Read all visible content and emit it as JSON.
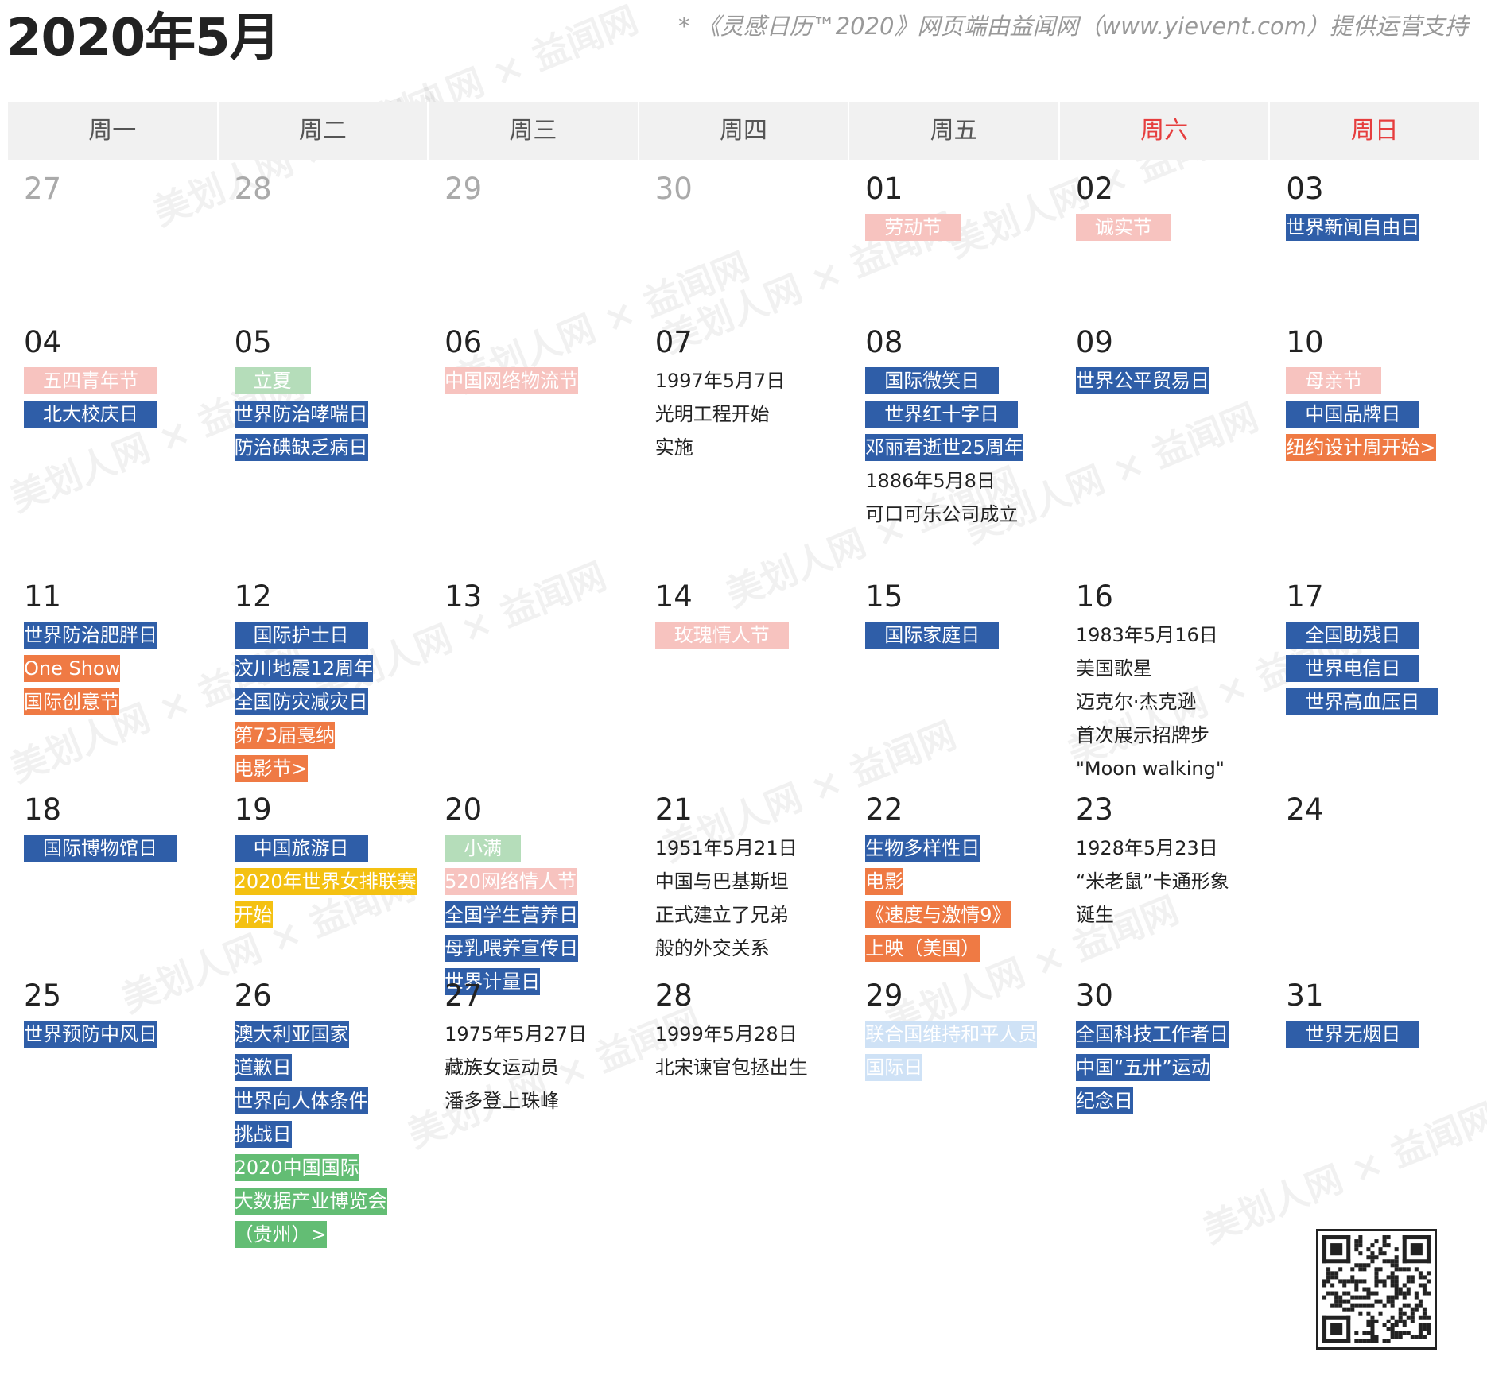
{
  "header": {
    "title": "2020年5月",
    "credit": "* 《灵感日历™2020》网页端由益闻网（www.yievent.com）提供运营支持"
  },
  "watermark": {
    "text": "美划人网 × 益闻网"
  },
  "weekdays": [
    {
      "label": "周一",
      "weekend": false
    },
    {
      "label": "周二",
      "weekend": false
    },
    {
      "label": "周三",
      "weekend": false
    },
    {
      "label": "周四",
      "weekend": false
    },
    {
      "label": "周五",
      "weekend": false
    },
    {
      "label": "周六",
      "weekend": true
    },
    {
      "label": "周日",
      "weekend": true
    }
  ],
  "weeks": [
    [
      {
        "day": "27",
        "other": true,
        "events": []
      },
      {
        "day": "28",
        "other": true,
        "events": []
      },
      {
        "day": "29",
        "other": true,
        "events": []
      },
      {
        "day": "30",
        "other": true,
        "events": []
      },
      {
        "day": "01",
        "events": [
          {
            "text": "劳动节",
            "color": "pink",
            "pad": true
          }
        ]
      },
      {
        "day": "02",
        "events": [
          {
            "text": "诚实节",
            "color": "pink",
            "pad": true
          }
        ]
      },
      {
        "day": "03",
        "events": [
          {
            "text": "世界新闻自由日",
            "color": "blue"
          }
        ]
      }
    ],
    [
      {
        "day": "04",
        "events": [
          {
            "text": "五四青年节",
            "color": "pink",
            "pad": true
          },
          {
            "text": "北大校庆日",
            "color": "blue",
            "pad": true
          }
        ]
      },
      {
        "day": "05",
        "events": [
          {
            "text": "立夏",
            "color": "green",
            "pad": true
          },
          {
            "text": "世界防治哮喘日",
            "color": "blue"
          },
          {
            "text": "防治碘缺乏病日",
            "color": "blue"
          }
        ]
      },
      {
        "day": "06",
        "events": [
          {
            "text": "中国网络物流节",
            "color": "pink"
          }
        ]
      },
      {
        "day": "07",
        "events": [
          {
            "text": "1997年5月7日",
            "color": "plain"
          },
          {
            "text": "光明工程开始",
            "color": "plain"
          },
          {
            "text": "实施",
            "color": "plain"
          }
        ]
      },
      {
        "day": "08",
        "events": [
          {
            "text": "国际微笑日",
            "color": "blue",
            "pad": true
          },
          {
            "text": "世界红十字日",
            "color": "blue",
            "pad": true
          },
          {
            "text": "邓丽君逝世25周年",
            "color": "blue"
          },
          {
            "text": "1886年5月8日",
            "color": "plain"
          },
          {
            "text": "可口可乐公司成立",
            "color": "plain"
          }
        ]
      },
      {
        "day": "09",
        "events": [
          {
            "text": "世界公平贸易日",
            "color": "blue"
          }
        ]
      },
      {
        "day": "10",
        "events": [
          {
            "text": "母亲节",
            "color": "pink",
            "pad": true
          },
          {
            "text": "中国品牌日",
            "color": "blue",
            "pad": true
          },
          {
            "text": "纽约设计周开始>",
            "color": "orange"
          }
        ]
      }
    ],
    [
      {
        "day": "11",
        "events": [
          {
            "text": "世界防治肥胖日",
            "color": "blue"
          },
          {
            "text": "One Show",
            "color": "orange"
          },
          {
            "text": "国际创意节",
            "color": "orange"
          }
        ]
      },
      {
        "day": "12",
        "events": [
          {
            "text": "国际护士日",
            "color": "blue",
            "pad": true
          },
          {
            "text": "汶川地震12周年",
            "color": "blue"
          },
          {
            "text": "全国防灾减灾日",
            "color": "blue"
          },
          {
            "text": "第73届戛纳",
            "color": "orange"
          },
          {
            "text": "电影节>",
            "color": "orange"
          }
        ]
      },
      {
        "day": "13",
        "events": []
      },
      {
        "day": "14",
        "events": [
          {
            "text": "玫瑰情人节",
            "color": "pink",
            "pad": true
          }
        ]
      },
      {
        "day": "15",
        "events": [
          {
            "text": "国际家庭日",
            "color": "blue",
            "pad": true
          }
        ]
      },
      {
        "day": "16",
        "events": [
          {
            "text": "1983年5月16日",
            "color": "plain"
          },
          {
            "text": "美国歌星",
            "color": "plain"
          },
          {
            "text": "迈克尔·杰克逊",
            "color": "plain"
          },
          {
            "text": "首次展示招牌步",
            "color": "plain"
          },
          {
            "text": "\"Moon walking\"",
            "color": "plain"
          }
        ]
      },
      {
        "day": "17",
        "events": [
          {
            "text": "全国助残日",
            "color": "blue",
            "pad": true
          },
          {
            "text": "世界电信日",
            "color": "blue",
            "pad": true
          },
          {
            "text": "世界高血压日",
            "color": "blue",
            "pad": true
          }
        ]
      }
    ],
    [
      {
        "day": "18",
        "events": [
          {
            "text": "国际博物馆日",
            "color": "blue",
            "pad": true
          }
        ]
      },
      {
        "day": "19",
        "events": [
          {
            "text": "中国旅游日",
            "color": "blue",
            "pad": true
          },
          {
            "text": "2020年世界女排联赛",
            "color": "yellow"
          },
          {
            "text": "开始",
            "color": "yellow"
          }
        ]
      },
      {
        "day": "20",
        "events": [
          {
            "text": "小满",
            "color": "green",
            "pad": true
          },
          {
            "text": "520网络情人节",
            "color": "pink"
          },
          {
            "text": "全国学生营养日",
            "color": "blue"
          },
          {
            "text": "母乳喂养宣传日",
            "color": "blue"
          },
          {
            "text": "世界计量日",
            "color": "blue"
          }
        ]
      },
      {
        "day": "21",
        "events": [
          {
            "text": "1951年5月21日",
            "color": "plain"
          },
          {
            "text": "中国与巴基斯坦",
            "color": "plain"
          },
          {
            "text": "正式建立了兄弟",
            "color": "plain"
          },
          {
            "text": "般的外交关系",
            "color": "plain"
          }
        ]
      },
      {
        "day": "22",
        "events": [
          {
            "text": "生物多样性日",
            "color": "blue"
          },
          {
            "text": "电影",
            "color": "orange"
          },
          {
            "text": "《速度与激情9》",
            "color": "orange"
          },
          {
            "text": "上映（美国）",
            "color": "orange"
          }
        ]
      },
      {
        "day": "23",
        "events": [
          {
            "text": "1928年5月23日",
            "color": "plain"
          },
          {
            "text": "“米老鼠”卡通形象",
            "color": "plain"
          },
          {
            "text": "诞生",
            "color": "plain"
          }
        ]
      },
      {
        "day": "24",
        "events": []
      }
    ],
    [
      {
        "day": "25",
        "events": [
          {
            "text": "世界预防中风日",
            "color": "blue"
          }
        ]
      },
      {
        "day": "26",
        "events": [
          {
            "text": "澳大利亚国家",
            "color": "blue"
          },
          {
            "text": "道歉日",
            "color": "blue"
          },
          {
            "text": "世界向人体条件",
            "color": "blue"
          },
          {
            "text": "挑战日",
            "color": "blue"
          },
          {
            "text": "2020中国国际",
            "color": "ltgreen"
          },
          {
            "text": "大数据产业博览会",
            "color": "ltgreen"
          },
          {
            "text": "（贵州）>",
            "color": "ltgreen"
          }
        ]
      },
      {
        "day": "27",
        "events": [
          {
            "text": "1975年5月27日",
            "color": "plain"
          },
          {
            "text": "藏族女运动员",
            "color": "plain"
          },
          {
            "text": "潘多登上珠峰",
            "color": "plain"
          }
        ]
      },
      {
        "day": "28",
        "events": [
          {
            "text": "1999年5月28日",
            "color": "plain"
          },
          {
            "text": "北宋谏官包拯出生",
            "color": "plain"
          }
        ]
      },
      {
        "day": "29",
        "events": [
          {
            "text": "联合国维持和平人员",
            "color": "ltblue"
          },
          {
            "text": "国际日",
            "color": "ltblue"
          }
        ]
      },
      {
        "day": "30",
        "events": [
          {
            "text": "全国科技工作者日",
            "color": "blue"
          },
          {
            "text": "中国“五卅”运动",
            "color": "blue"
          },
          {
            "text": "纪念日",
            "color": "blue"
          }
        ]
      },
      {
        "day": "31",
        "events": [
          {
            "text": "世界无烟日",
            "color": "blue",
            "pad": true
          }
        ]
      }
    ]
  ],
  "qr": {
    "icon": "qr-code-icon"
  }
}
